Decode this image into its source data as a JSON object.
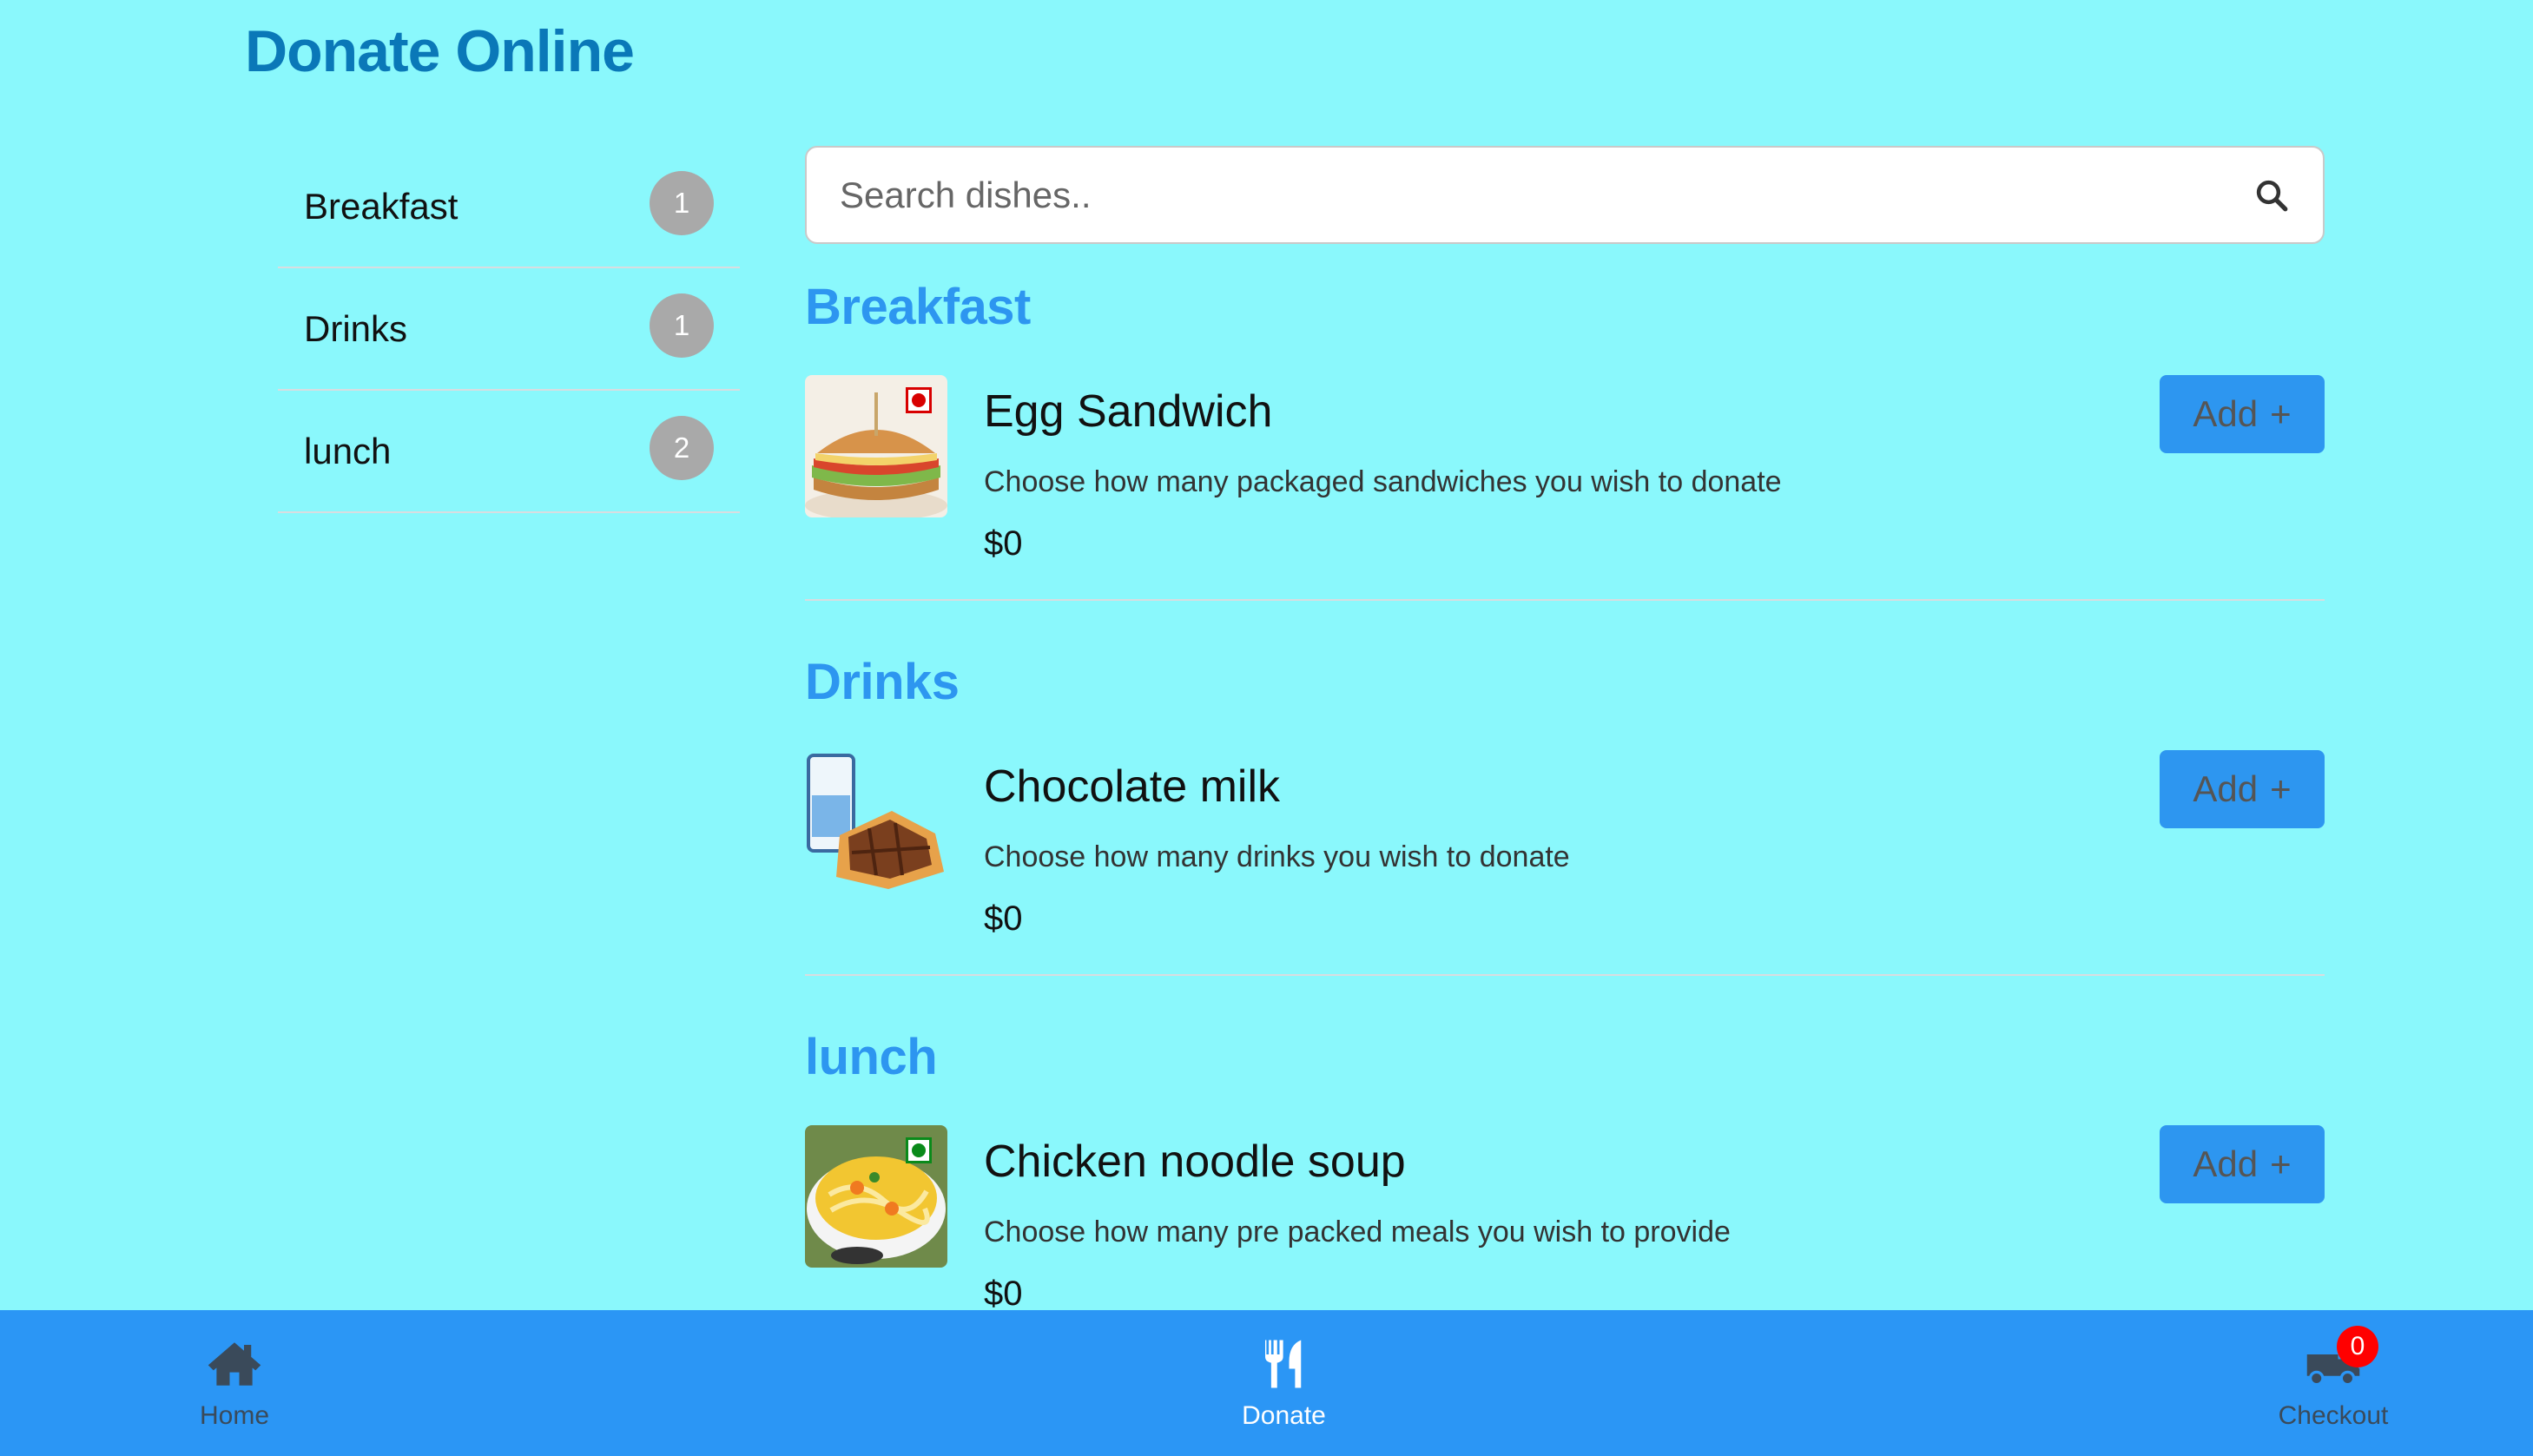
{
  "header": {
    "title": "Donate Online"
  },
  "sidebar": {
    "items": [
      {
        "label": "Breakfast",
        "count": "1"
      },
      {
        "label": "Drinks",
        "count": "1"
      },
      {
        "label": "lunch",
        "count": "2"
      }
    ]
  },
  "search": {
    "placeholder": "Search dishes.."
  },
  "sections": [
    {
      "title": "Breakfast",
      "dishes": [
        {
          "name": "Egg Sandwich",
          "description": "Choose how many packaged sandwiches you wish to donate",
          "price": "$0",
          "add_label": "Add",
          "image_icon": "sandwich-image"
        }
      ]
    },
    {
      "title": "Drinks",
      "dishes": [
        {
          "name": "Chocolate milk",
          "description": "Choose how many drinks you wish to donate",
          "price": "$0",
          "add_label": "Add",
          "image_icon": "chocolate-milk-image"
        }
      ]
    },
    {
      "title": "lunch",
      "dishes": [
        {
          "name": "Chicken noodle soup",
          "description": "Choose how many pre packed meals you wish to provide",
          "price": "$0",
          "add_label": "Add",
          "image_icon": "noodle-soup-image"
        }
      ]
    }
  ],
  "bottom_nav": {
    "home_label": "Home",
    "donate_label": "Donate",
    "checkout_label": "Checkout",
    "cart_count": "0"
  },
  "colors": {
    "background": "#8af8fc",
    "title": "#0a78b8",
    "section_title": "#2d96f0",
    "nav_bar": "#2b96f5",
    "badge": "#ff0000"
  }
}
